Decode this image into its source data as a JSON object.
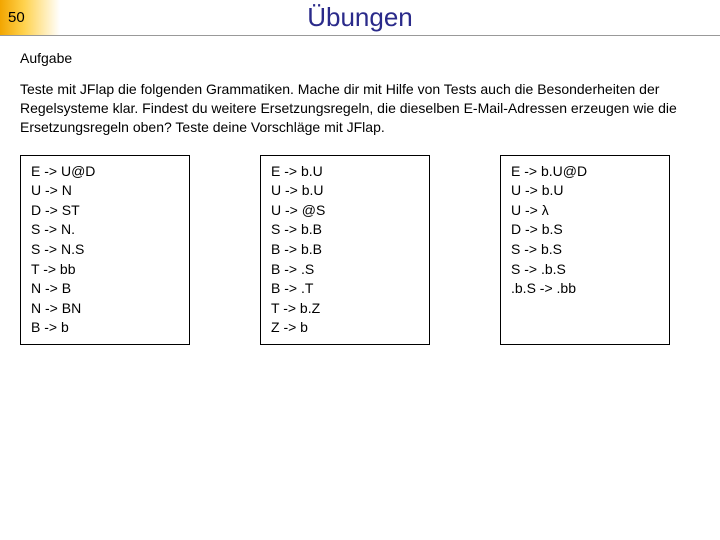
{
  "slide_number": "50",
  "title": "Übungen",
  "subheading": "Aufgabe",
  "paragraph": "Teste mit JFlap die folgenden Grammatiken. Mache dir mit Hilfe von Tests auch die Besonderheiten der Regelsysteme klar. Findest du weitere Ersetzungsregeln, die dieselben E-Mail-Adressen erzeugen wie die Ersetzungsregeln oben? Teste deine Vorschläge mit JFlap.",
  "grammars": [
    "E -> U@D\nU -> N\nD -> ST\nS -> N.\nS -> N.S\nT -> bb\nN -> B\nN -> BN\nB -> b",
    "E -> b.U\nU -> b.U\nU -> @S\nS -> b.B\nB -> b.B\nB -> .S\nB -> .T\nT -> b.Z\nZ -> b",
    "E -> b.U@D\nU -> b.U\nU -> λ\nD -> b.S\nS -> b.S\nS -> .b.S\n.b.S -> .bb"
  ]
}
